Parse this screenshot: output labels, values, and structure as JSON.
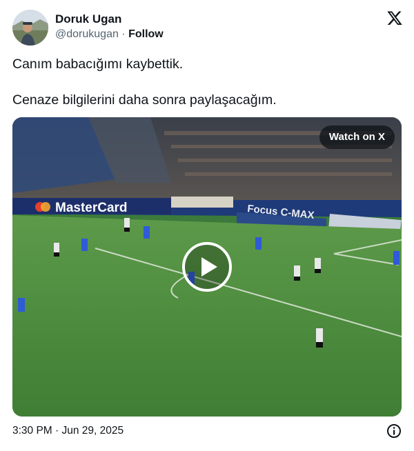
{
  "author": {
    "name": "Doruk Ugan",
    "handle": "@dorukugan",
    "separator": "·",
    "follow_label": "Follow",
    "avatar_icon": "user-avatar"
  },
  "brand_icon": "x-logo-icon",
  "tweet": {
    "line1": "Canım babacığımı kaybettik.",
    "line2": "Cenaze bilgilerini daha sonra paylaşacağım."
  },
  "media": {
    "watch_label": "Watch on X",
    "play_icon": "play-icon",
    "ad_boards": [
      "MasterCard",
      "Focus C-MAX"
    ]
  },
  "footer": {
    "timestamp": "3:30 PM · Jun 29, 2025",
    "info_icon": "info-icon"
  },
  "colors": {
    "text": "#0f1419",
    "secondary": "#536471",
    "pitch": "#4a8a3e"
  }
}
